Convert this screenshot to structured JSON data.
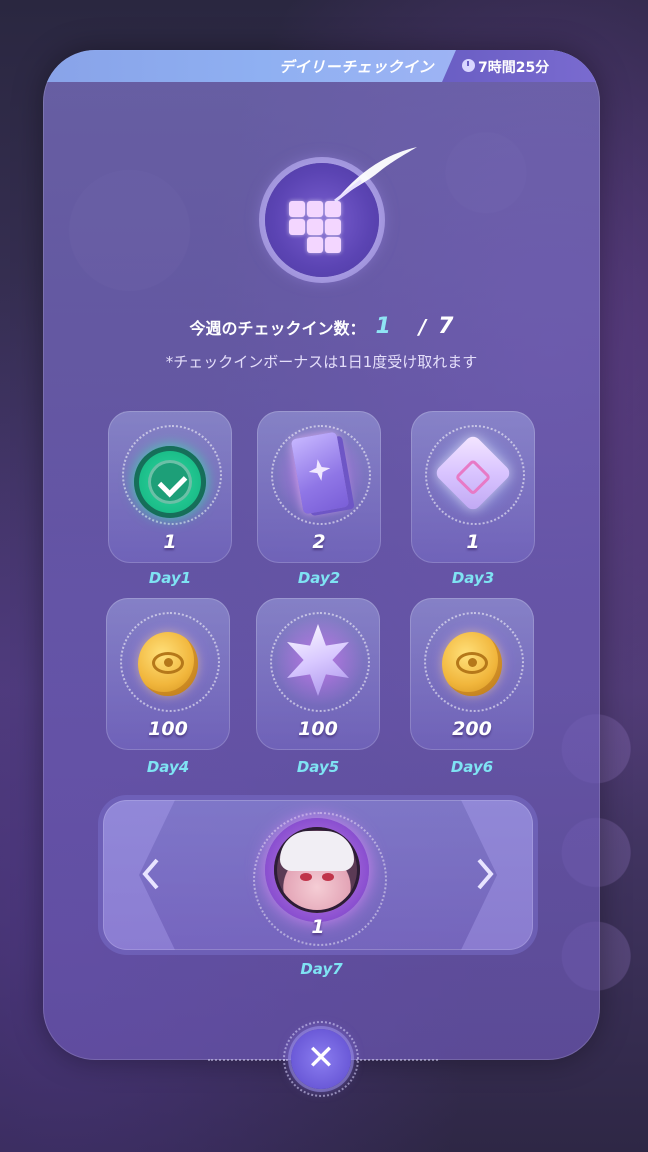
{
  "dialog": {
    "title": "デイリーチェックイン",
    "timer": "7時間25分",
    "checkin_label": "今週のチェックイン数：",
    "checkin_current": "1",
    "checkin_separator": "/",
    "checkin_total": "7",
    "note": "*チェックインボーナスは1日1度受け取れます"
  },
  "rewards": [
    {
      "day": "Day1",
      "qty": "1",
      "icon": "checked-badge-icon",
      "claimed": true
    },
    {
      "day": "Day2",
      "qty": "2",
      "icon": "tarot-card-icon"
    },
    {
      "day": "Day3",
      "qty": "1",
      "icon": "crystal-cube-icon"
    },
    {
      "day": "Day4",
      "qty": "100",
      "icon": "gold-coin-icon"
    },
    {
      "day": "Day5",
      "qty": "100",
      "icon": "star-crystal-icon"
    },
    {
      "day": "Day6",
      "qty": "200",
      "icon": "gold-coin-icon"
    }
  ],
  "grand_reward": {
    "day": "Day7",
    "qty": "1",
    "icon": "character-avatar-icon"
  },
  "close": {
    "label": "✕"
  },
  "colors": {
    "accent_cyan": "#7fe3f3",
    "panel": "#6f5fbf",
    "title_bar": "#8fb0f2",
    "claimed_green": "#2fd7a0"
  }
}
